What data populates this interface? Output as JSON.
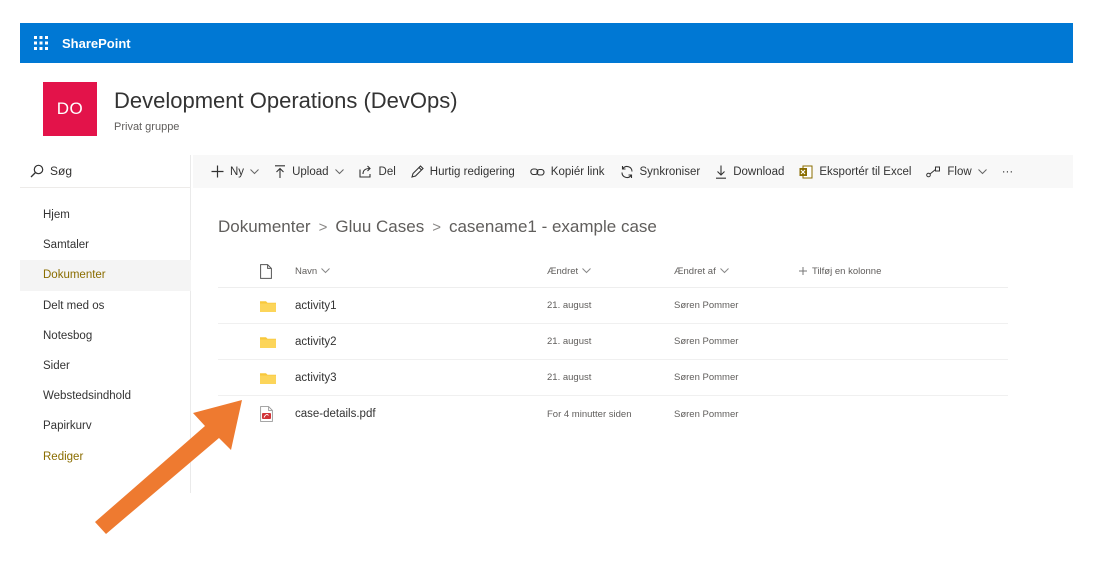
{
  "suite": {
    "app_name": "SharePoint"
  },
  "site": {
    "logo_initials": "DO",
    "title": "Development Operations (DevOps)",
    "subtitle": "Privat gruppe",
    "logo_color": "#e3134a"
  },
  "search": {
    "label": "Søg"
  },
  "nav": {
    "items": [
      {
        "label": "Hjem"
      },
      {
        "label": "Samtaler"
      },
      {
        "label": "Dokumenter"
      },
      {
        "label": "Delt med os"
      },
      {
        "label": "Notesbog"
      },
      {
        "label": "Sider"
      },
      {
        "label": "Webstedsindhold"
      },
      {
        "label": "Papirkurv"
      },
      {
        "label": "Rediger"
      }
    ]
  },
  "commands": {
    "new": "Ny",
    "upload": "Upload",
    "share": "Del",
    "quick_edit": "Hurtig redigering",
    "copy_link": "Kopiér link",
    "sync": "Synkroniser",
    "download": "Download",
    "export_excel": "Eksportér til Excel",
    "flow": "Flow",
    "more": "···"
  },
  "breadcrumb": {
    "items": [
      "Dokumenter",
      "Gluu Cases",
      "casename1 - example case"
    ],
    "separator": ">"
  },
  "columns": {
    "name": "Navn",
    "modified": "Ændret",
    "modified_by": "Ændret af",
    "add_column": "Tilføj en kolonne"
  },
  "files": [
    {
      "type": "folder",
      "name": "activity1",
      "modified": "21. august",
      "modified_by": "Søren Pommer"
    },
    {
      "type": "folder",
      "name": "activity2",
      "modified": "21. august",
      "modified_by": "Søren Pommer"
    },
    {
      "type": "folder",
      "name": "activity3",
      "modified": "21. august",
      "modified_by": "Søren Pommer"
    },
    {
      "type": "pdf",
      "name": "case-details.pdf",
      "modified": "For 4 minutter siden",
      "modified_by": "Søren Pommer"
    }
  ],
  "colors": {
    "suite_bar": "#0078d4",
    "accent_text": "#8a6d00",
    "folder": "#f8c83c",
    "arrow": "#ee7a30"
  }
}
